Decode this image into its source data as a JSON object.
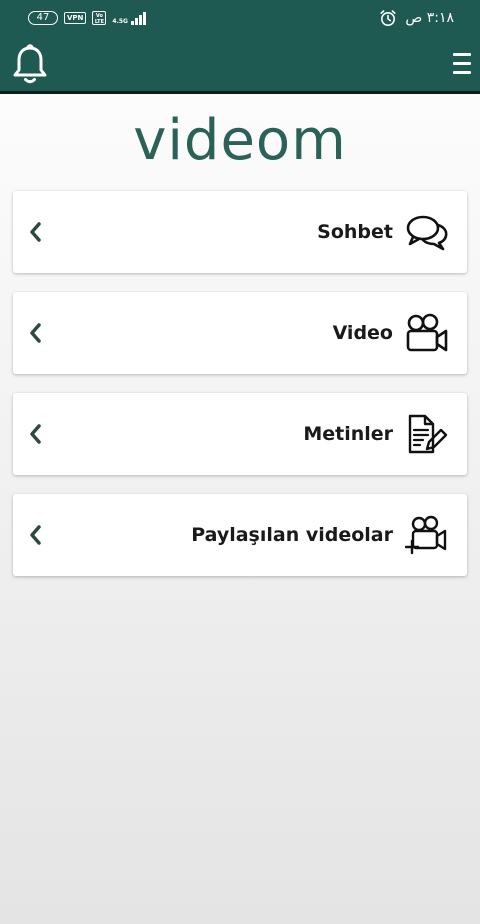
{
  "status_bar": {
    "battery": "47",
    "vpn": "VPN",
    "volte": "Vo LTE",
    "network": "4.5G",
    "time": "٣:١٨ ص"
  },
  "app_bar": {
    "bell_icon": "bell-icon",
    "menu_icon": "hamburger-icon"
  },
  "logo": "videom",
  "menu": [
    {
      "label": "Sohbet",
      "icon": "chat-bubbles-icon"
    },
    {
      "label": "Video",
      "icon": "video-camera-icon"
    },
    {
      "label": "Metinler",
      "icon": "document-pen-icon"
    },
    {
      "label": "Paylaşılan videolar",
      "icon": "video-camera-plus-icon"
    }
  ],
  "colors": {
    "primary": "#1f5a52",
    "logo": "#2a6258",
    "chevron": "#2d4a3e"
  }
}
